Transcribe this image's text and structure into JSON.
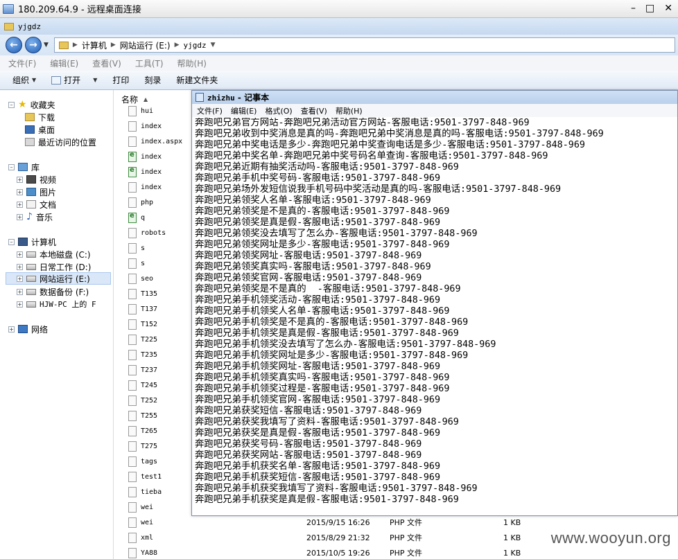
{
  "remote_desktop": {
    "title": "180.209.64.9 - 远程桌面连接"
  },
  "explorer": {
    "caption": "yjgdz",
    "address": {
      "crumbs": [
        "计算机",
        "网站运行 (E:)",
        "yjgdz"
      ]
    },
    "menu": [
      "文件(F)",
      "编辑(E)",
      "查看(V)",
      "工具(T)",
      "帮助(H)"
    ],
    "commands": {
      "organize": "组织",
      "open": "打开",
      "print": "打印",
      "burn": "刻录",
      "new_folder": "新建文件夹"
    },
    "nav": {
      "favorites": "收藏夹",
      "downloads": "下载",
      "desktop": "桌面",
      "recent": "最近访问的位置",
      "libraries": "库",
      "videos": "视频",
      "pictures": "图片",
      "documents": "文档",
      "music": "音乐",
      "computer": "计算机",
      "drive_c": "本地磁盘 (C:)",
      "drive_d": "日常工作 (D:)",
      "drive_e": "网站运行 (E:)",
      "drive_f": "数据备份 (F:)",
      "net_drive": "HJW-PC 上的 F",
      "network": "网络"
    },
    "column_name": "名称",
    "files": [
      {
        "name": "hui",
        "type": "doc"
      },
      {
        "name": "index",
        "type": "doc"
      },
      {
        "name": "index.aspx",
        "type": "blank"
      },
      {
        "name": "index",
        "type": "ie"
      },
      {
        "name": "index",
        "type": "ie"
      },
      {
        "name": "index",
        "type": "doc"
      },
      {
        "name": "php",
        "type": "blank"
      },
      {
        "name": "q",
        "type": "ie"
      },
      {
        "name": "robots",
        "type": "doc"
      },
      {
        "name": "s",
        "type": "doc"
      },
      {
        "name": "s",
        "type": "doc"
      },
      {
        "name": "seo",
        "type": "doc"
      },
      {
        "name": "T135",
        "type": "doc"
      },
      {
        "name": "T137",
        "type": "doc"
      },
      {
        "name": "T152",
        "type": "doc"
      },
      {
        "name": "T225",
        "type": "doc"
      },
      {
        "name": "T235",
        "type": "doc"
      },
      {
        "name": "T237",
        "type": "doc"
      },
      {
        "name": "T245",
        "type": "doc"
      },
      {
        "name": "T252",
        "type": "doc"
      },
      {
        "name": "T255",
        "type": "doc"
      },
      {
        "name": "T265",
        "type": "doc"
      },
      {
        "name": "T275",
        "type": "doc"
      },
      {
        "name": "tags",
        "type": "doc"
      },
      {
        "name": "test1",
        "type": "doc"
      },
      {
        "name": "tieba",
        "type": "doc"
      },
      {
        "name": "wei",
        "type": "doc"
      },
      {
        "name": "wei",
        "type": "doc"
      },
      {
        "name": "xml",
        "type": "doc"
      },
      {
        "name": "YA88",
        "type": "doc"
      }
    ],
    "file_details": [
      {
        "date": "2015/9/15 16:26",
        "type": "PHP 文件",
        "size": "1 KB"
      },
      {
        "date": "2015/8/29 21:32",
        "type": "PHP 文件",
        "size": "1 KB"
      },
      {
        "date": "2015/10/5 19:26",
        "type": "PHP 文件",
        "size": "1 KB"
      }
    ]
  },
  "notepad": {
    "title_file": "zhizhu",
    "title_app": " - 记事本",
    "menu": [
      "文件(F)",
      "编辑(E)",
      "格式(O)",
      "查看(V)",
      "帮助(H)"
    ],
    "lines": [
      "奔跑吧兄弟官方网站-奔跑吧兄弟活动官方网站-客服电话:9501-3797-848-969",
      "奔跑吧兄弟收到中奖消息是真的吗-奔跑吧兄弟中奖消息是真的吗-客服电话:9501-3797-848-969",
      "奔跑吧兄弟中奖电话是多少-奔跑吧兄弟中奖查询电话是多少-客服电话:9501-3797-848-969",
      "奔跑吧兄弟中奖名单-奔跑吧兄弟中奖号码名单查询-客服电话:9501-3797-848-969",
      "奔跑吧兄弟近期有抽奖活动吗-客服电话:9501-3797-848-969",
      "奔跑吧兄弟手机中奖号码-客服电话:9501-3797-848-969",
      "奔跑吧兄弟场外发短信说我手机号码中奖活动是真的吗-客服电话:9501-3797-848-969",
      "奔跑吧兄弟领奖人名单-客服电话:9501-3797-848-969",
      "奔跑吧兄弟领奖是不是真的-客服电话:9501-3797-848-969",
      "奔跑吧兄弟领奖是真是假-客服电话:9501-3797-848-969",
      "奔跑吧兄弟领奖没去填写了怎么办-客服电话:9501-3797-848-969",
      "奔跑吧兄弟领奖网址是多少-客服电话:9501-3797-848-969",
      "奔跑吧兄弟领奖网址-客服电话:9501-3797-848-969",
      "奔跑吧兄弟领奖真实吗-客服电话:9501-3797-848-969",
      "奔跑吧兄弟领奖官网-客服电话:9501-3797-848-969",
      "奔跑吧兄弟领奖是不是真的  -客服电话:9501-3797-848-969",
      "奔跑吧兄弟手机领奖活动-客服电话:9501-3797-848-969",
      "奔跑吧兄弟手机领奖人名单-客服电话:9501-3797-848-969",
      "奔跑吧兄弟手机领奖是不是真的-客服电话:9501-3797-848-969",
      "奔跑吧兄弟手机领奖是真是假-客服电话:9501-3797-848-969",
      "奔跑吧兄弟手机领奖没去填写了怎么办-客服电话:9501-3797-848-969",
      "奔跑吧兄弟手机领奖网址是多少-客服电话:9501-3797-848-969",
      "奔跑吧兄弟手机领奖网址-客服电话:9501-3797-848-969",
      "奔跑吧兄弟手机领奖真实吗-客服电话:9501-3797-848-969",
      "奔跑吧兄弟手机领奖过程是-客服电话:9501-3797-848-969",
      "奔跑吧兄弟手机领奖官网-客服电话:9501-3797-848-969",
      "奔跑吧兄弟获奖短信-客服电话:9501-3797-848-969",
      "奔跑吧兄弟获奖我填写了资料-客服电话:9501-3797-848-969",
      "奔跑吧兄弟获奖是真是假-客服电话:9501-3797-848-969",
      "奔跑吧兄弟获奖号码-客服电话:9501-3797-848-969",
      "奔跑吧兄弟获奖网站-客服电话:9501-3797-848-969",
      "奔跑吧兄弟手机获奖名单-客服电话:9501-3797-848-969",
      "奔跑吧兄弟手机获奖短信-客服电话:9501-3797-848-969",
      "奔跑吧兄弟手机获奖我填写了资料-客服电话:9501-3797-848-969",
      "奔跑吧兄弟手机获奖是真是假-客服电话:9501-3797-848-969"
    ]
  },
  "watermark": "www.wooyun.org"
}
